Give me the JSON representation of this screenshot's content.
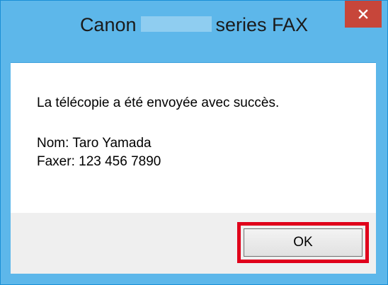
{
  "dialog": {
    "title_prefix": "Canon",
    "title_suffix": "series FAX",
    "close_label": "×"
  },
  "content": {
    "message": "La télécopie a été envoyée avec succès.",
    "name_line": "Nom: Taro Yamada",
    "faxer_line": "Faxer: 123 456 7890"
  },
  "footer": {
    "ok_label": "OK"
  },
  "colors": {
    "title_bar": "#5db7ea",
    "close_button": "#c7463a",
    "highlight": "#e0001b",
    "footer": "#efefef"
  }
}
